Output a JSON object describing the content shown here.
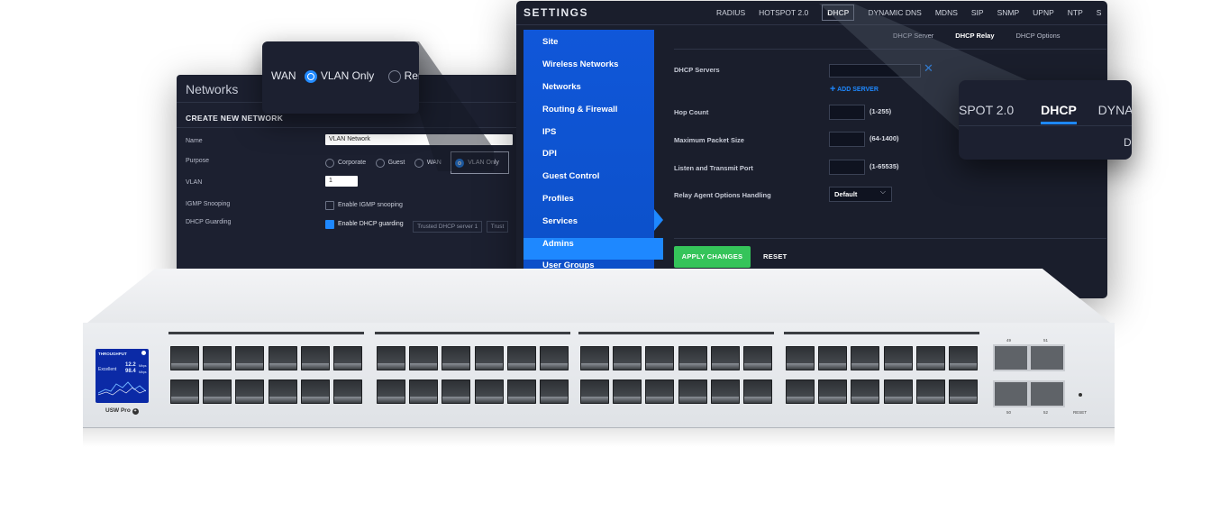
{
  "networks": {
    "title": "Networks",
    "section": "CREATE NEW NETWORK",
    "rows": [
      {
        "label": "Name",
        "value": "VLAN Network"
      },
      {
        "label": "Purpose"
      },
      {
        "label": "VLAN",
        "value": "1"
      },
      {
        "label": "IGMP Snooping",
        "value": "Enable IGMP snooping"
      },
      {
        "label": "DHCP Guarding",
        "value": "Enable DHCP guarding",
        "placeholder": "Trusted DHCP server 1",
        "placeholder2": "Trust"
      }
    ],
    "purpose_options": [
      "Corporate",
      "Guest",
      "WAN",
      "VLAN Only",
      "Re"
    ],
    "purpose_selected": "VLAN Only"
  },
  "popup_purpose": {
    "options": [
      "WAN",
      "VLAN Only",
      "Remo"
    ]
  },
  "popup_tabs": {
    "items": [
      "SPOT 2.0",
      "DHCP",
      "DYNAMIC"
    ],
    "sub": "D"
  },
  "settings": {
    "title": "SETTINGS",
    "tabs": [
      "RADIUS",
      "HOTSPOT 2.0",
      "DHCP",
      "DYNAMIC DNS",
      "MDNS",
      "SIP",
      "SNMP",
      "UPNP",
      "NTP",
      "S"
    ],
    "active_tab": "DHCP",
    "subtabs": [
      "DHCP Server",
      "DHCP Relay",
      "DHCP Options"
    ],
    "active_subtab": "DHCP Relay",
    "sidebar": [
      "Site",
      "Wireless Networks",
      "Networks",
      "Routing & Firewall",
      "IPS",
      "DPI",
      "Guest Control",
      "Profiles",
      "Services",
      "Admins",
      "User Groups"
    ],
    "sidebar_active": "Services",
    "fields": {
      "dhcp_servers": "DHCP Servers",
      "add_server": "ADD SERVER",
      "hop_count": "Hop Count",
      "hop_hint": "(1-255)",
      "max_packet": "Maximum Packet Size",
      "max_hint": "(64-1400)",
      "listen": "Listen and Transmit Port",
      "listen_hint": "(1-65535)",
      "relay": "Relay Agent Options Handling",
      "relay_value": "Default"
    },
    "apply": "APPLY CHANGES",
    "reset": "RESET"
  },
  "switch": {
    "brand": "USW Pro",
    "lcd": {
      "title": "THROUGHPUT",
      "status": "Excellent",
      "v1": "12.2",
      "v2": "98.4",
      "u1": "Mbps",
      "u2": "Mbps"
    },
    "sfp_top": [
      "49",
      "51"
    ],
    "sfp_bottom": [
      "50",
      "52"
    ],
    "reset_label": "RESET",
    "colors": {
      "lcd": "#0b2aa6",
      "accent": "#1e88ff",
      "apply": "#35c45a",
      "sidebar": "#1057d9"
    }
  }
}
